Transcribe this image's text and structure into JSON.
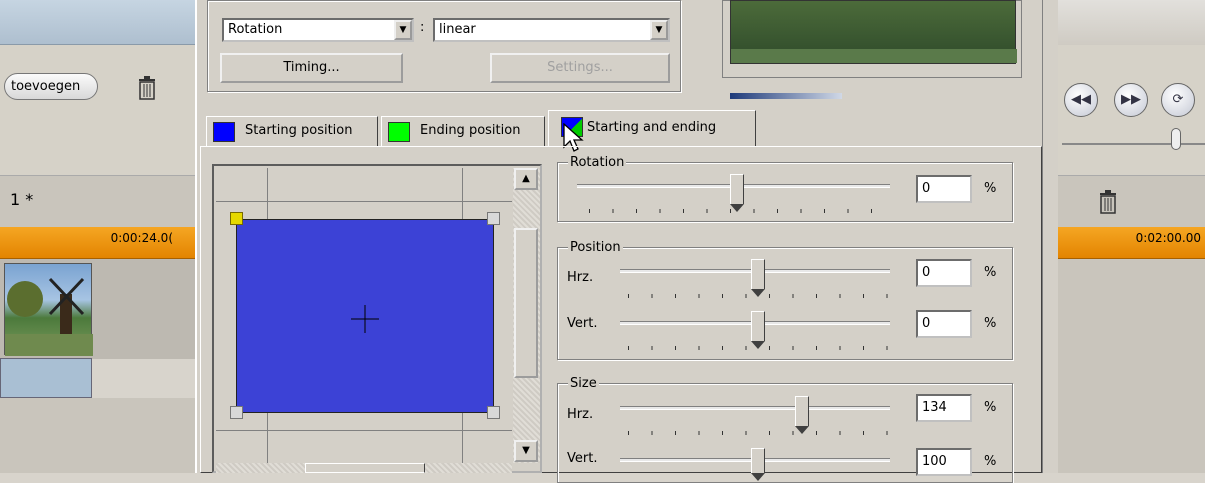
{
  "left_app": {
    "add_button": "toevoegen",
    "track_label": "1 *",
    "time": "0:00:24.0("
  },
  "right_app": {
    "time": "0:02:00.00",
    "buttons": [
      "◀◀",
      "▶▶",
      "⟳"
    ]
  },
  "dialog": {
    "property_select": "Rotation",
    "colon": ":",
    "interpolation_select": "linear",
    "timing_button": "Timing...",
    "settings_button": "Settings...",
    "tabs": [
      {
        "label": "Starting position",
        "color": "#0000ff"
      },
      {
        "label": "Ending position",
        "color": "#00ff00"
      },
      {
        "label": "Starting and ending",
        "color": "#0000ff"
      }
    ],
    "preview_color": "#3c42d6",
    "rotation": {
      "legend": "Rotation",
      "value": "0",
      "unit": "%"
    },
    "position": {
      "legend": "Position",
      "hrz_label": "Hrz.",
      "hrz_value": "0",
      "vert_label": "Vert.",
      "vert_value": "0",
      "unit": "%"
    },
    "size": {
      "legend": "Size",
      "hrz_label": "Hrz.",
      "hrz_value": "134",
      "vert_label": "Vert.",
      "vert_value": "100",
      "unit": "%"
    }
  }
}
